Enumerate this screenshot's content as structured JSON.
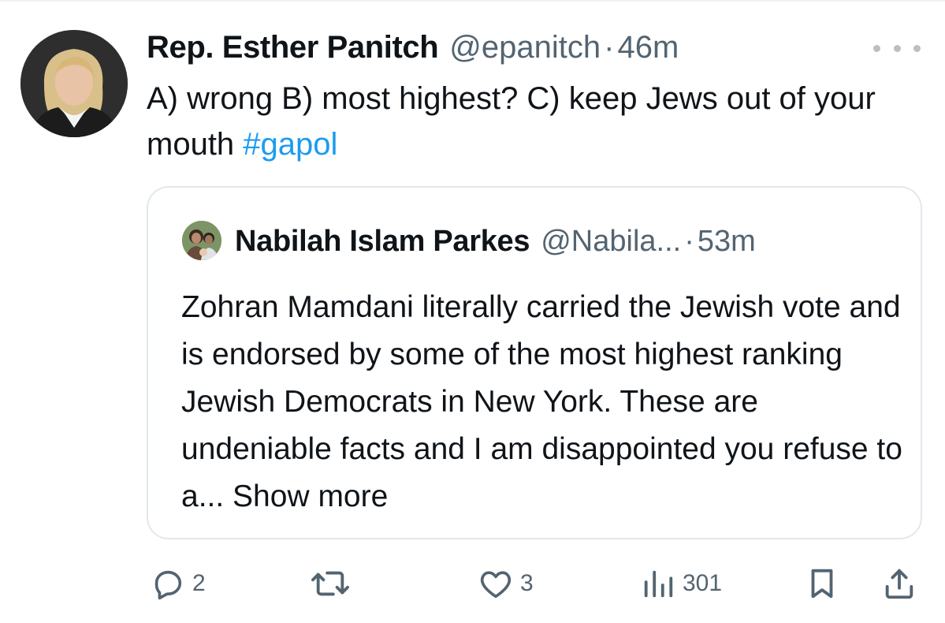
{
  "tweet": {
    "display_name": "Rep. Esther Panitch",
    "handle": "@epanitch",
    "separator": "·",
    "time": "46m",
    "text_main": "A) wrong B) most highest? C) keep Jews out of your mouth ",
    "hashtag": "#gapol"
  },
  "quote": {
    "display_name": "Nabilah Islam Parkes",
    "handle": "@Nabila...",
    "separator": "·",
    "time": "53m",
    "text": "Zohran Mamdani literally carried the Jewish vote and is endorsed by some of the most highest ranking Jewish Democrats in New York. These are undeniable facts and I am disappointed you refuse to a... ",
    "show_more": "Show more"
  },
  "actions": {
    "replies": "2",
    "retweets": "",
    "likes": "3",
    "views": "301"
  },
  "icons": {
    "more": "more-dots-icon",
    "reply": "reply-icon",
    "retweet": "retweet-icon",
    "like": "heart-icon",
    "views": "views-chart-icon",
    "bookmark": "bookmark-icon",
    "share": "share-icon"
  },
  "colors": {
    "text": "#0f1419",
    "secondary": "#536471",
    "link": "#1d9bf0",
    "border": "#e1e8ed"
  }
}
